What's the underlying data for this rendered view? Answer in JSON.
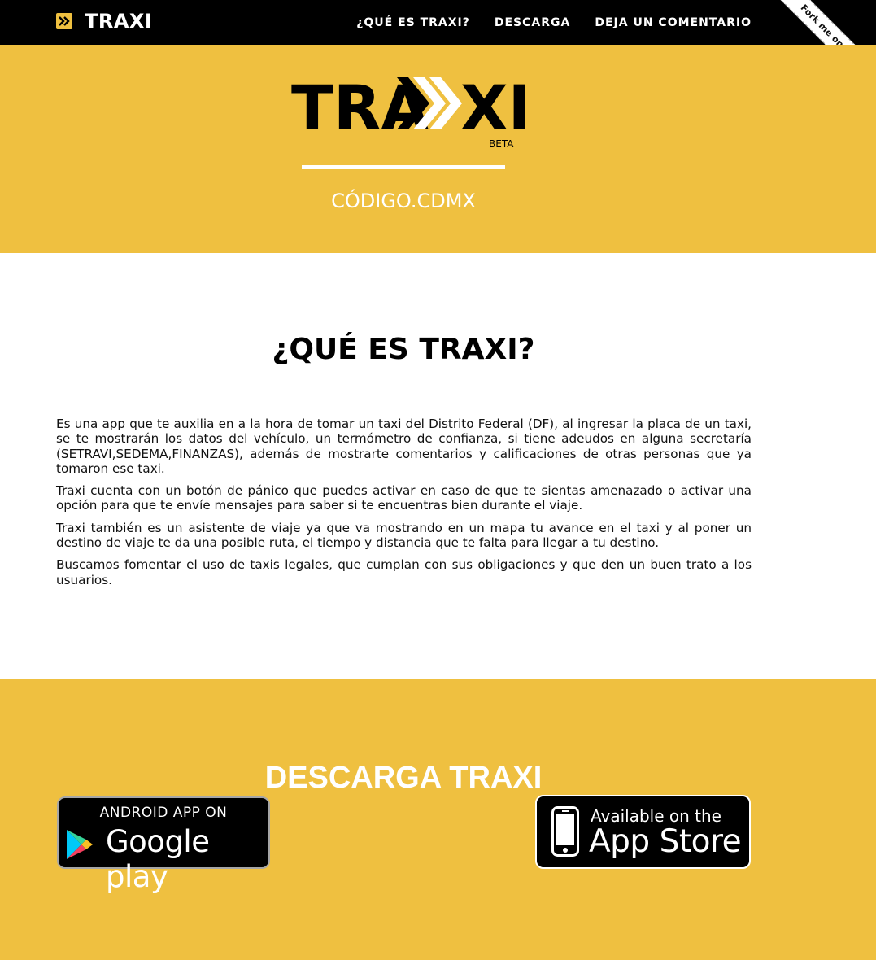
{
  "navbar": {
    "brand": "TRAXI",
    "links": [
      "¿QUÉ ES TRAXI?",
      "DESCARGA",
      "DEJA UN COMENTARIO"
    ]
  },
  "ribbon": {
    "label": "Fork me on GitHub"
  },
  "hero": {
    "logo_text": "TRA",
    "logo_text_end": "XI",
    "logo_badge": "BETA",
    "subtitle": "CÓDIGO.CDMX"
  },
  "about": {
    "title": "¿QUÉ ES TRAXI?",
    "paragraphs": [
      "Es una app que te auxilia en a la hora de tomar un taxi del Distrito Federal (DF), al ingresar la placa de un taxi, se te mostrarán los datos del vehículo, un termómetro de confianza, si tiene adeudos en alguna secretaría (SETRAVI,SEDEMA,FINANZAS), además de mostrarte comentarios y calificaciones de otras personas que ya tomaron ese taxi.",
      "Traxi cuenta con un botón de pánico que puedes activar en caso de que te sientas amenazado o activar una opción para que te envíe mensajes para saber si te encuentras bien durante el viaje.",
      "Traxi también es un asistente de viaje ya que va mostrando en un mapa tu avance en el taxi y al poner un destino de viaje te da una posible ruta, el tiempo y distancia que te falta para llegar a tu destino.",
      "Buscamos fomentar el uso de taxis legales, que cumplan con sus obligaciones y que den un buen trato a los usuarios."
    ]
  },
  "download": {
    "title": "DESCARGA TRAXI",
    "google_play": {
      "top": "ANDROID APP ON",
      "main": "Google play"
    },
    "app_store": {
      "top": "Available on the",
      "main": "App Store"
    }
  },
  "colors": {
    "accent": "#EFC040",
    "nav": "#000000"
  }
}
